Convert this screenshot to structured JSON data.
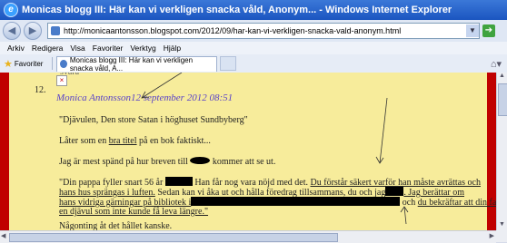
{
  "window": {
    "title": "Monicas blogg III: Här kan vi verkligen snacka våld, Anonym... - Windows Internet Explorer"
  },
  "address": {
    "url": "http://monicaantonsson.blogspot.com/2012/09/har-kan-vi-verkligen-snacka-vald-anonym.html"
  },
  "menu": [
    "Arkiv",
    "Redigera",
    "Visa",
    "Favoriter",
    "Verktyg",
    "Hjälp"
  ],
  "favorites": {
    "label": "Favoriter"
  },
  "tab": {
    "label": "Monicas blogg III: Här kan vi verkligen snacka våld, A..."
  },
  "comment": {
    "prev_fragment": "svara",
    "number": "12.",
    "author": "Monica Antonsson",
    "timestamp": "12 september 2012 08:51",
    "p1": "\"Djävulen, Den store Satan i höghuset Sundbyberg\"",
    "p2_a": "Låter som en ",
    "p2_link": "bra titel",
    "p2_b": " på en bok faktiskt...",
    "p3_a": "Jag är mest spänd på hur breven till ",
    "p3_b": " kommer att se ut.",
    "q_l1_a": "\"Din pappa fyller snart 56 år",
    "q_l1_b": "Han får nog vara nöjd med det. ",
    "q_l1_c": "Du förstår säkert varför han måste avrättas och",
    "q_l2_a": "hans hus sprängas i luften.",
    "q_l2_b": " Sedan kan vi åka ut och hålla föredrag tillsammans, du och jag",
    "q_l2_c": ". Jag berättar om",
    "q_l3_a": "hans vidriga gärningar på bibliotek i",
    "q_l3_b": " och ",
    "q_l3_c": "du bekräftar att din far var",
    "q_l4": "en djävul som inte kunde få leva längre.\"",
    "p5": "Någonting åt det hållet kanske."
  }
}
